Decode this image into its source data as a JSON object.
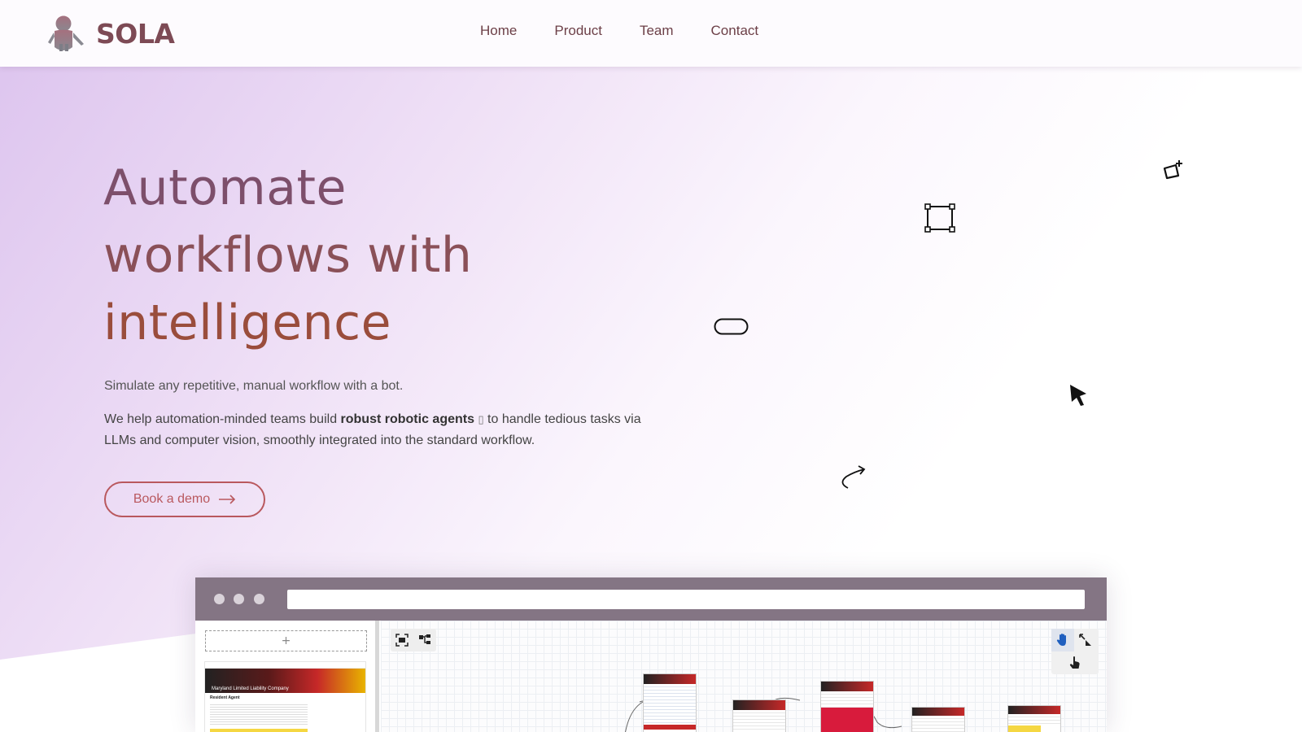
{
  "brand": {
    "name": "SOLA",
    "primary": "#7d4a55",
    "accent": "#b9585e"
  },
  "nav": {
    "items": [
      "Home",
      "Product",
      "Team",
      "Contact"
    ]
  },
  "hero": {
    "title_lines": [
      "Automate",
      "workflows with",
      "intelligence"
    ],
    "subtitle": "Simulate any repetitive, manual workflow with a bot.",
    "desc_before": "We help automation-minded teams build ",
    "desc_bold": "robust robotic agents",
    "desc_glyph": "▯",
    "desc_after": " to handle tedious tasks via LLMs and computer vision, smoothly integrated into the standard workflow.",
    "cta_label": "Book a demo",
    "cta_icon": "arrow-right-icon"
  },
  "decorations": [
    "sparkle-box-icon",
    "bounding-box-icon",
    "pill-shape-icon",
    "cursor-pointer-icon",
    "curved-arrow-icon"
  ],
  "mockup": {
    "add_label": "+",
    "canvas_tools_left": [
      "fit-view-icon",
      "layout-tree-icon"
    ],
    "canvas_tools_right": [
      "hand-pan-icon",
      "resize-arrows-icon",
      "touch-pointer-icon"
    ],
    "thumbnail_caption": "Maryland Limited Liability Company",
    "thumbnail_heading": "Resident Agent"
  }
}
